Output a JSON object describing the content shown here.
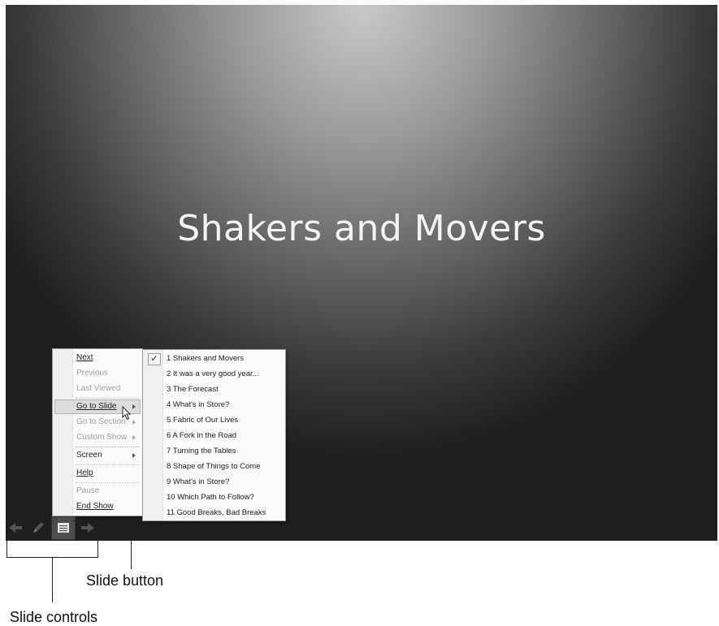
{
  "slide": {
    "title": "Shakers and Movers"
  },
  "popup_menu": {
    "items": [
      {
        "label": "Next",
        "enabled": true
      },
      {
        "label": "Previous",
        "enabled": false
      },
      {
        "label": "Last Viewed",
        "enabled": false
      },
      {
        "label": "Go to Slide",
        "enabled": true,
        "submenu": true
      },
      {
        "label": "Go to Section",
        "enabled": false,
        "submenu": true
      },
      {
        "label": "Custom Show",
        "enabled": false,
        "submenu": true
      },
      {
        "label": "Screen",
        "enabled": true,
        "submenu": true
      },
      {
        "label": "Help",
        "enabled": true
      },
      {
        "label": "Pause",
        "enabled": false
      },
      {
        "label": "End Show",
        "enabled": true
      }
    ]
  },
  "submenu": {
    "checked_mark": "✓",
    "items": [
      "1 Shakers and Movers",
      "2 It was a very good year...",
      "3 The Forecast",
      "4 What's in Store?",
      "5 Fabric of Our Lives",
      "6 A Fork in the Road",
      "7 Turning the Tables",
      "8 Shape of Things to Come",
      "9 What's in Store?",
      "10 Which Path to Follow?",
      "11 Good Breaks, Bad Breaks"
    ]
  },
  "controls": {
    "icons": [
      "previous-arrow-icon",
      "pen-icon",
      "slide-menu-icon",
      "next-arrow-icon"
    ]
  },
  "callouts": {
    "slide_button": "Slide button",
    "slide_controls": "Slide controls"
  }
}
